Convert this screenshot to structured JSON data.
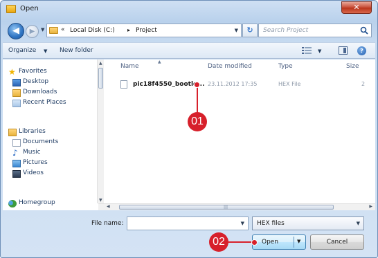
{
  "window": {
    "title": "Open",
    "close_label": "✕"
  },
  "address": {
    "back_glyph": "◀",
    "forward_glyph": "▶",
    "chevron": "«",
    "crumbs": [
      "Local Disk (C:)",
      "Project"
    ],
    "separator": "▸",
    "refresh_glyph": "↻",
    "search_placeholder": "Search Project"
  },
  "toolbar": {
    "organize_label": "Organize",
    "new_folder_label": "New folder",
    "help_label": "?"
  },
  "nav": {
    "favorites": {
      "label": "Favorites",
      "items": [
        "Desktop",
        "Downloads",
        "Recent Places"
      ]
    },
    "libraries": {
      "label": "Libraries",
      "items": [
        "Documents",
        "Music",
        "Pictures",
        "Videos"
      ]
    },
    "homegroup_label": "Homegroup"
  },
  "filelist": {
    "columns": [
      "Name",
      "Date modified",
      "Type",
      "Size"
    ],
    "rows": [
      {
        "name": "pic18f4550_bootlo...",
        "date": "23.11.2012 17:35",
        "type": "HEX File",
        "size": "2"
      }
    ]
  },
  "bottom": {
    "file_name_label": "File name:",
    "file_name_value": "",
    "file_type_value": "HEX files",
    "open_label": "Open",
    "cancel_label": "Cancel"
  },
  "callouts": [
    "01",
    "02"
  ],
  "colors": {
    "callout": "#d7202b",
    "window_frame": "#b9d1ec",
    "accent_button": "#bee6fd"
  }
}
